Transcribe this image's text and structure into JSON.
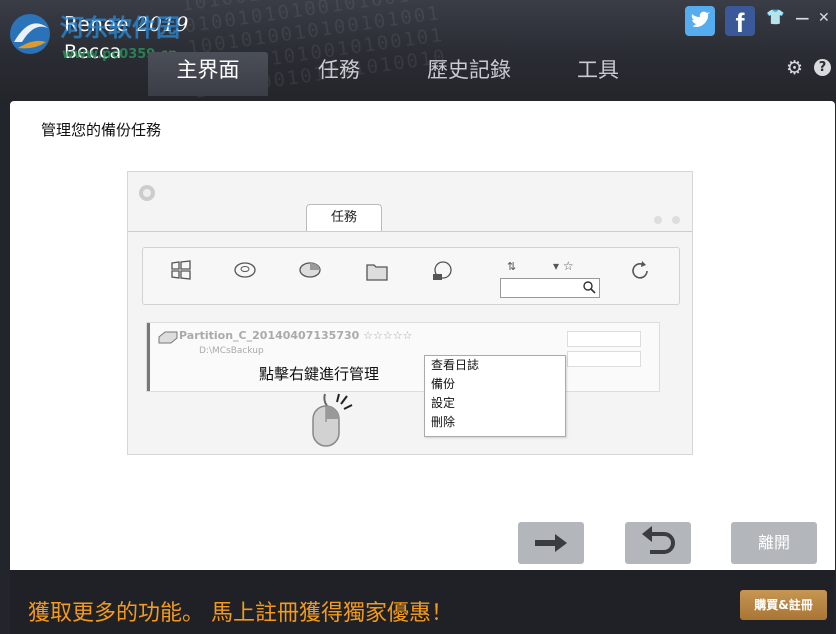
{
  "app": {
    "name": "Renee",
    "year": "2019",
    "product": "Becca",
    "watermark_cn": "河东软件园",
    "watermark_url": "www.pc0359.cn"
  },
  "binary_pattern": "10100101001010\n010010101001010010\n1001010010100101001\n0101001010010100101\n1010100101001010010",
  "nav": {
    "tabs": [
      "主界面",
      "任務",
      "歷史記錄",
      "工具"
    ],
    "active_index": 0
  },
  "social": {
    "twitter": "twitter-icon",
    "facebook_glyph": "f"
  },
  "window_icons": {
    "shirt": "👕",
    "minimize": "−",
    "close": "✕",
    "settings": "⚙",
    "help": "?"
  },
  "panel": {
    "title": "管理您的備份任務"
  },
  "preview": {
    "tab_label": "任務",
    "partition_label": "Partition_C_20140407135730 ☆☆☆☆☆",
    "path_label": "D:\\MCsBackup",
    "hint": "點擊右鍵進行管理",
    "context_menu": [
      "查看日誌",
      "備份",
      "設定",
      "刪除"
    ],
    "toolbar_filter_arrows": "⇅",
    "toolbar_filter_star": "▾ ☆"
  },
  "buttons": {
    "next_icon": "→",
    "undo_icon": "↶",
    "exit_label": "離開"
  },
  "promo": {
    "text": "獲取更多的功能。 馬上註冊獲得獨家優惠！",
    "buy_label": "購買&註冊"
  },
  "colors": {
    "accent_orange": "#f39a1e",
    "buy_button": "#b8853f",
    "topbar": "#2d3037"
  }
}
